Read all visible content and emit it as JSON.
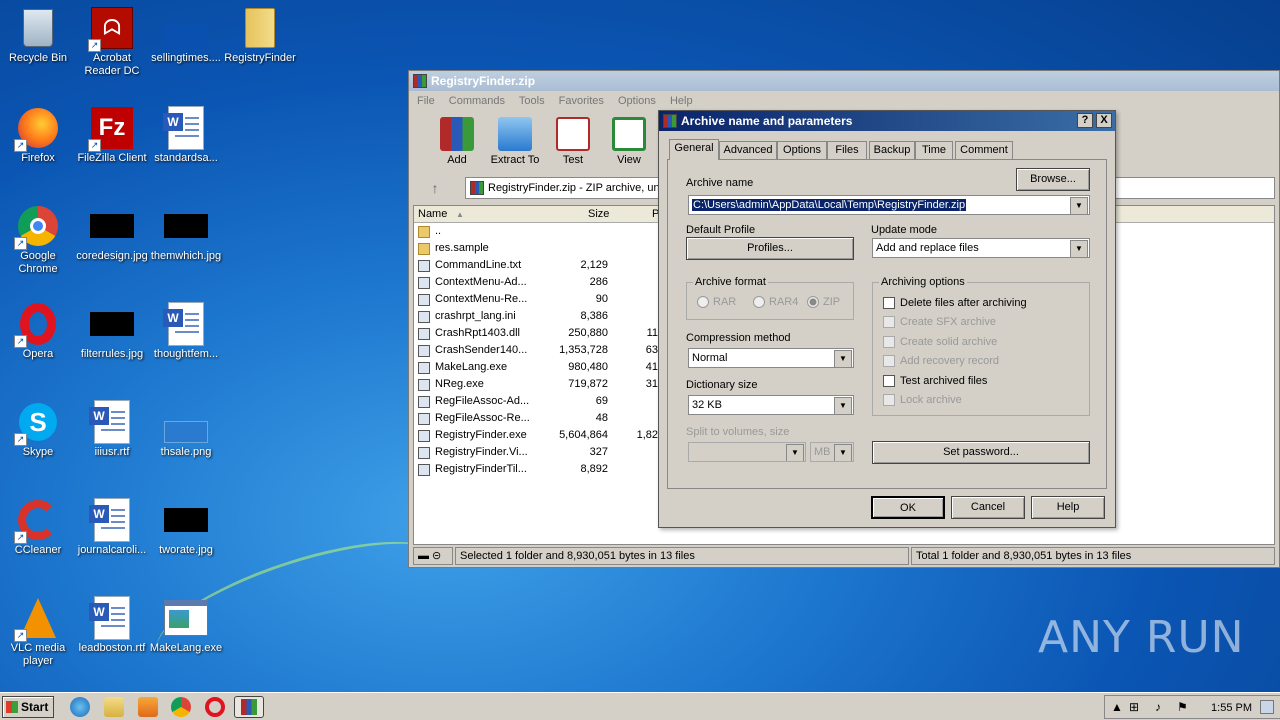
{
  "desktop": {
    "icons": [
      {
        "label": "Recycle Bin"
      },
      {
        "label": "Acrobat Reader DC"
      },
      {
        "label": "sellingtimes...."
      },
      {
        "label": "RegistryFinder"
      },
      {
        "label": "Firefox"
      },
      {
        "label": "FileZilla Client"
      },
      {
        "label": "standardsa..."
      },
      {
        "label": "Google Chrome"
      },
      {
        "label": "coredesign.jpg"
      },
      {
        "label": "themwhich.jpg"
      },
      {
        "label": "Opera"
      },
      {
        "label": "filterrules.jpg"
      },
      {
        "label": "thoughtfem..."
      },
      {
        "label": "Skype"
      },
      {
        "label": "iiiusr.rtf"
      },
      {
        "label": "thsale.png"
      },
      {
        "label": "CCleaner"
      },
      {
        "label": "journalcaroli..."
      },
      {
        "label": "tworate.jpg"
      },
      {
        "label": "VLC media player"
      },
      {
        "label": "leadboston.rtf"
      },
      {
        "label": "MakeLang.exe"
      }
    ],
    "watermark": "ANY RUN"
  },
  "winrar": {
    "title": "RegistryFinder.zip",
    "menu": [
      "File",
      "Commands",
      "Tools",
      "Favorites",
      "Options",
      "Help"
    ],
    "toolbar": {
      "add": "Add",
      "extract": "Extract To",
      "test": "Test",
      "view": "View"
    },
    "address": "RegistryFinder.zip - ZIP archive, un",
    "columns": {
      "name": "Name",
      "size": "Size",
      "packed": "P"
    },
    "files": [
      {
        "name": "..",
        "size": "",
        "packed": "",
        "type": "folder"
      },
      {
        "name": "res.sample",
        "size": "",
        "packed": "",
        "type": "folder"
      },
      {
        "name": "CommandLine.txt",
        "size": "2,129",
        "packed": "",
        "type": "file"
      },
      {
        "name": "ContextMenu-Ad...",
        "size": "286",
        "packed": "",
        "type": "file"
      },
      {
        "name": "ContextMenu-Re...",
        "size": "90",
        "packed": "",
        "type": "file"
      },
      {
        "name": "crashrpt_lang.ini",
        "size": "8,386",
        "packed": "",
        "type": "file"
      },
      {
        "name": "CrashRpt1403.dll",
        "size": "250,880",
        "packed": "11",
        "type": "file"
      },
      {
        "name": "CrashSender140...",
        "size": "1,353,728",
        "packed": "63",
        "type": "file"
      },
      {
        "name": "MakeLang.exe",
        "size": "980,480",
        "packed": "41",
        "type": "file"
      },
      {
        "name": "NReg.exe",
        "size": "719,872",
        "packed": "31",
        "type": "file"
      },
      {
        "name": "RegFileAssoc-Ad...",
        "size": "69",
        "packed": "",
        "type": "file"
      },
      {
        "name": "RegFileAssoc-Re...",
        "size": "48",
        "packed": "",
        "type": "file"
      },
      {
        "name": "RegistryFinder.exe",
        "size": "5,604,864",
        "packed": "1,82",
        "type": "file"
      },
      {
        "name": "RegistryFinder.Vi...",
        "size": "327",
        "packed": "",
        "type": "file"
      },
      {
        "name": "RegistryFinderTil...",
        "size": "8,892",
        "packed": "",
        "type": "file"
      }
    ],
    "status_left": "Selected 1 folder and 8,930,051 bytes in 13 files",
    "status_right": "Total 1 folder and 8,930,051 bytes in 13 files"
  },
  "dialog": {
    "title": "Archive name and parameters",
    "help_btn": "?",
    "close_btn": "X",
    "tabs": [
      "General",
      "Advanced",
      "Options",
      "Files",
      "Backup",
      "Time",
      "Comment"
    ],
    "archive_name_label": "Archive name",
    "browse": "Browse...",
    "archive_name_value": "C:\\Users\\admin\\AppData\\Local\\Temp\\RegistryFinder.zip",
    "default_profile_label": "Default Profile",
    "profiles": "Profiles...",
    "update_mode_label": "Update mode",
    "update_mode_value": "Add and replace files",
    "archive_format_label": "Archive format",
    "formats": [
      "RAR",
      "RAR4",
      "ZIP"
    ],
    "compression_label": "Compression method",
    "compression_value": "Normal",
    "dictionary_label": "Dictionary size",
    "dictionary_value": "32 KB",
    "split_label": "Split to volumes, size",
    "split_unit": "MB",
    "archiving_options_label": "Archiving options",
    "options": [
      {
        "label": "Delete files after archiving",
        "enabled": true,
        "checked": false
      },
      {
        "label": "Create SFX archive",
        "enabled": false,
        "checked": false
      },
      {
        "label": "Create solid archive",
        "enabled": false,
        "checked": false
      },
      {
        "label": "Add recovery record",
        "enabled": false,
        "checked": false
      },
      {
        "label": "Test archived files",
        "enabled": true,
        "checked": false
      },
      {
        "label": "Lock archive",
        "enabled": false,
        "checked": false
      }
    ],
    "set_password": "Set password...",
    "ok": "OK",
    "cancel": "Cancel",
    "help": "Help"
  },
  "taskbar": {
    "start": "Start",
    "clock": "1:55 PM"
  }
}
